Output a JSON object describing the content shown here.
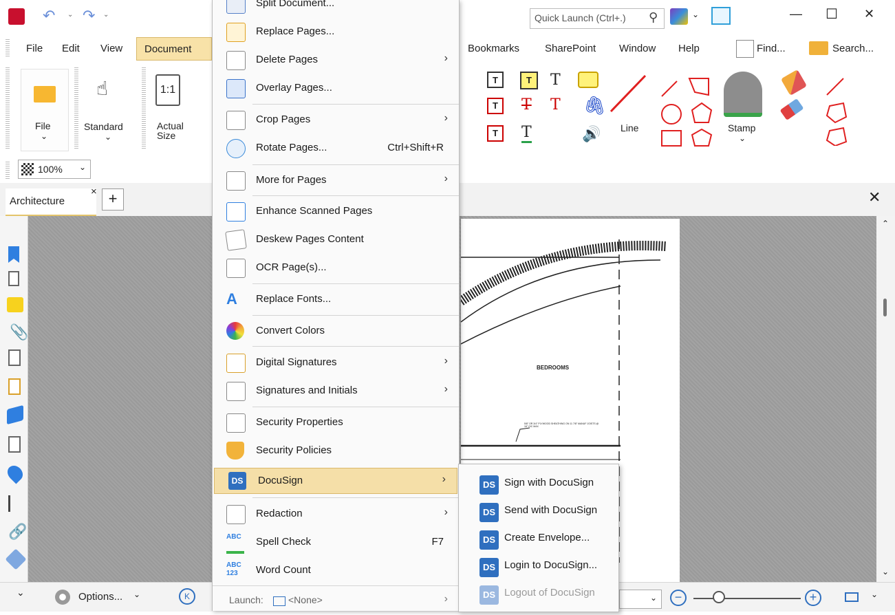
{
  "titlebar": {
    "quick_launch_placeholder": "Quick Launch (Ctrl+.)",
    "minimize": "—",
    "maximize": "☐",
    "close": "✕"
  },
  "menubar": {
    "items": [
      "File",
      "Edit",
      "View",
      "Document",
      "Bookmarks",
      "SharePoint",
      "Window",
      "Help"
    ],
    "find": "Find...",
    "search": "Search..."
  },
  "ribbon": {
    "file": "File",
    "standard": "Standard",
    "actual_size": "Actual Size",
    "one_to_one": "1:1",
    "line": "Line",
    "stamp": "Stamp"
  },
  "zoom": {
    "value": "100%"
  },
  "tabs": {
    "active": "Architecture",
    "close": "×",
    "add": "+"
  },
  "document_menu": {
    "items": [
      {
        "label": "Split Document...",
        "icon": "split-document-icon",
        "arrow": false
      },
      {
        "label": "Replace Pages...",
        "icon": "replace-pages-icon",
        "arrow": false
      },
      {
        "label": "Delete Pages",
        "icon": "delete-pages-icon",
        "arrow": true
      },
      {
        "label": "Overlay Pages...",
        "icon": "overlay-pages-icon",
        "arrow": false
      },
      {
        "label": "Crop Pages",
        "icon": "crop-pages-icon",
        "arrow": true
      },
      {
        "label": "Rotate Pages...",
        "icon": "rotate-pages-icon",
        "shortcut": "Ctrl+Shift+R"
      },
      {
        "label": "More for Pages",
        "icon": "more-pages-icon",
        "arrow": true
      },
      {
        "label": "Enhance Scanned Pages",
        "icon": "enhance-scanned-icon",
        "arrow": false
      },
      {
        "label": "Deskew Pages Content",
        "icon": "deskew-icon",
        "arrow": false
      },
      {
        "label": "OCR Page(s)...",
        "icon": "ocr-icon",
        "arrow": false
      },
      {
        "label": "Replace Fonts...",
        "icon": "replace-fonts-icon",
        "arrow": false
      },
      {
        "label": "Convert Colors",
        "icon": "convert-colors-icon",
        "arrow": false
      },
      {
        "label": "Digital Signatures",
        "icon": "digital-signatures-icon",
        "arrow": true
      },
      {
        "label": "Signatures and Initials",
        "icon": "signatures-initials-icon",
        "arrow": true
      },
      {
        "label": "Security Properties",
        "icon": "security-properties-icon",
        "arrow": false
      },
      {
        "label": "Security Policies",
        "icon": "security-policies-icon",
        "arrow": false
      },
      {
        "label": "DocuSign",
        "icon": "docusign-icon",
        "arrow": true,
        "highlighted": true
      },
      {
        "label": "Redaction",
        "icon": "redaction-icon",
        "arrow": true
      },
      {
        "label": "Spell Check",
        "icon": "spell-check-icon",
        "shortcut": "F7"
      },
      {
        "label": "Word Count",
        "icon": "word-count-icon",
        "arrow": false
      },
      {
        "label": "Launch:",
        "icon": "",
        "arrow": true
      }
    ],
    "launch_value": "<None>"
  },
  "docusign_submenu": {
    "items": [
      {
        "label": "Sign with DocuSign",
        "enabled": true
      },
      {
        "label": "Send with DocuSign",
        "enabled": true
      },
      {
        "label": "Create Envelope...",
        "enabled": true
      },
      {
        "label": "Login to DocuSign...",
        "enabled": true
      },
      {
        "label": "Logout of DocuSign",
        "enabled": false
      }
    ]
  },
  "document": {
    "room_label": "BEDROOMS",
    "small_text": "5/8\" OR 3/4\" PLYWOOD SHEATHING ON 11 7/8\" MANUF JOISTS @ 16\" O/C MAX"
  },
  "statusbar": {
    "options": "Options..."
  },
  "colors": {
    "menu_highlight": "#f5dfa8",
    "docusign_blue": "#2f6fbf",
    "document_tab_active": "#f8e2a8"
  }
}
